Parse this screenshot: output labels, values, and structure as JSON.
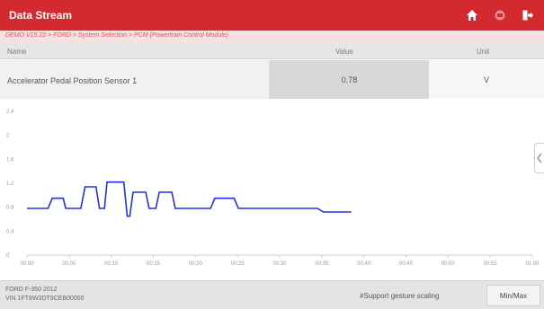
{
  "header": {
    "title": "Data Stream",
    "buttons": [
      {
        "icon": "home-icon"
      },
      {
        "icon": "print-icon"
      },
      {
        "icon": "exit-icon"
      }
    ],
    "color": "#d32a30"
  },
  "breadcrumb": "DEMO V15.22 > FORD > System Selection > PCM (Powertrain Control Module)",
  "columns": {
    "name": "Name",
    "value": "Value",
    "unit": "Unit"
  },
  "row": {
    "name": "Accelerator Pedal Position Sensor 1",
    "value": "0.78",
    "unit": "V"
  },
  "chart_data": {
    "type": "line",
    "x_ticks": [
      "00:00",
      "00:05",
      "00:10",
      "00:15",
      "00:20",
      "00:25",
      "00:30",
      "00:35",
      "00:40",
      "00:45",
      "00:50",
      "00:55",
      "01:00"
    ],
    "y_ticks": [
      "0",
      "0.4",
      "0.8",
      "1.2",
      "1.6",
      "2",
      "2.4"
    ],
    "ylim": [
      0,
      2.4
    ],
    "xlim": [
      0,
      60
    ],
    "line_color": "#2330e0",
    "series": [
      {
        "points": [
          [
            0,
            0.78
          ],
          [
            2.5,
            0.78
          ],
          [
            3,
            0.95
          ],
          [
            4.3,
            0.95
          ],
          [
            4.6,
            0.78
          ],
          [
            6.4,
            0.78
          ],
          [
            6.9,
            1.14
          ],
          [
            8.2,
            1.14
          ],
          [
            8.6,
            0.78
          ],
          [
            9.2,
            0.78
          ],
          [
            9.5,
            1.22
          ],
          [
            11.5,
            1.22
          ],
          [
            11.9,
            0.65
          ],
          [
            12.2,
            0.65
          ],
          [
            12.6,
            1.05
          ],
          [
            14.1,
            1.05
          ],
          [
            14.5,
            0.78
          ],
          [
            15.3,
            0.78
          ],
          [
            15.7,
            1.05
          ],
          [
            17.2,
            1.05
          ],
          [
            17.6,
            0.78
          ],
          [
            21.8,
            0.78
          ],
          [
            22.3,
            0.95
          ],
          [
            24.6,
            0.95
          ],
          [
            25.1,
            0.78
          ],
          [
            34.5,
            0.78
          ],
          [
            35.2,
            0.72
          ],
          [
            38.5,
            0.72
          ]
        ]
      }
    ]
  },
  "footer": {
    "vehicle_line1": "FORD F-350 2012",
    "vehicle_line2": "VIN 1FT8W3DT9CEB00000",
    "hint": "#Support gesture scaling",
    "button": "Min/Max"
  }
}
